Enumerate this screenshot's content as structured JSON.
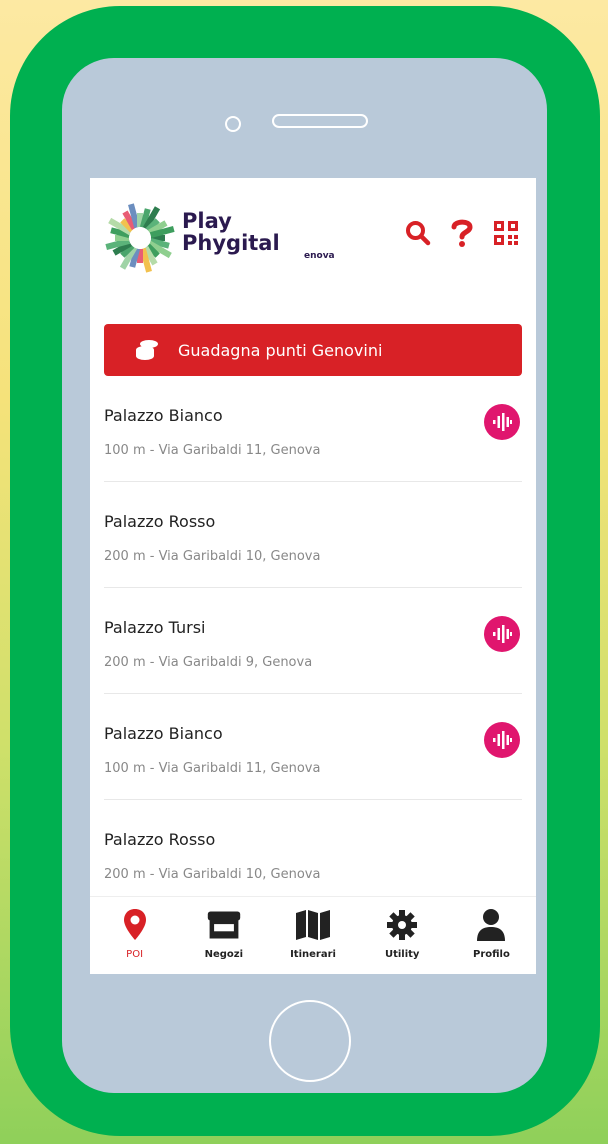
{
  "app": {
    "logo": {
      "line1": "Play",
      "line2": "Phygital",
      "line3": "enova",
      "icon": "sunburst-logo"
    },
    "colors": {
      "frame": "#00b050",
      "accent": "#d82126",
      "audio": "#e0166e"
    }
  },
  "header": {
    "icons": [
      "search-icon",
      "help-icon",
      "qrcode-icon"
    ]
  },
  "banner": {
    "label": "Guadagna punti Genovini",
    "icon": "coins-icon"
  },
  "poi_list": [
    {
      "title": "Palazzo Bianco",
      "subtitle": "100 m - Via Garibaldi 11, Genova",
      "audio": true
    },
    {
      "title": "Palazzo Rosso",
      "subtitle": "200 m - Via Garibaldi 10, Genova",
      "audio": false
    },
    {
      "title": "Palazzo Tursi",
      "subtitle": "200 m - Via Garibaldi 9, Genova",
      "audio": true
    },
    {
      "title": "Palazzo Bianco",
      "subtitle": "100 m - Via Garibaldi 11, Genova",
      "audio": true
    },
    {
      "title": "Palazzo Rosso",
      "subtitle": "200 m - Via Garibaldi 10, Genova",
      "audio": false
    }
  ],
  "tabs": [
    {
      "label": "POI",
      "icon": "map-pin-icon",
      "active": true
    },
    {
      "label": "Negozi",
      "icon": "store-icon",
      "active": false
    },
    {
      "label": "Itinerari",
      "icon": "map-icon",
      "active": false
    },
    {
      "label": "Utility",
      "icon": "gear-icon",
      "active": false
    },
    {
      "label": "Profilo",
      "icon": "user-icon",
      "active": false
    }
  ]
}
